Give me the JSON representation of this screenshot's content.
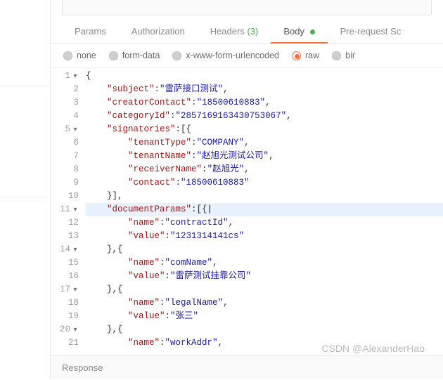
{
  "tabs": {
    "params": "Params",
    "authorization": "Authorization",
    "headers": "Headers",
    "headers_count": "(3)",
    "body": "Body",
    "prerequest": "Pre-request Sc"
  },
  "body_types": {
    "none": "none",
    "form_data": "form-data",
    "x_www": "x-www-form-urlencoded",
    "raw": "raw",
    "binary": "bir"
  },
  "code": {
    "l1": "{",
    "l2_key": "\"subject\"",
    "l2_val": "\"雷萨接口测试\"",
    "l3_key": "\"creatorContact\"",
    "l3_val": "\"18500610883\"",
    "l4_key": "\"categoryId\"",
    "l4_val": "\"2857169163430753067\"",
    "l5_key": "\"signatories\"",
    "l5_suffix": ":[{",
    "l6_key": "\"tenantType\"",
    "l6_val": "\"COMPANY\"",
    "l7_key": "\"tenantName\"",
    "l7_val": "\"赵旭光测试公司\"",
    "l8_key": "\"receiverName\"",
    "l8_val": "\"赵旭光\"",
    "l9_key": "\"contact\"",
    "l9_val": "\"18500610883\"",
    "l10": "}],",
    "l11_key": "\"documentParams\"",
    "l11_suffix": ":[{",
    "l12_key": "\"name\"",
    "l12_val": "\"contractId\"",
    "l13_key": "\"value\"",
    "l13_val": "\"1231314141cs\"",
    "l14": "},{",
    "l15_key": "\"name\"",
    "l15_val": "\"comName\"",
    "l16_key": "\"value\"",
    "l16_val": "\"雷萨测试挂靠公司\"",
    "l17": "},{",
    "l18_key": "\"name\"",
    "l18_val": "\"legalName\"",
    "l19_key": "\"value\"",
    "l19_val": "\"张三\"",
    "l20": "},{",
    "l21_key": "\"name\"",
    "l21_val": "\"workAddr\""
  },
  "response_label": "Response",
  "watermark": "CSDN @AlexanderHao"
}
